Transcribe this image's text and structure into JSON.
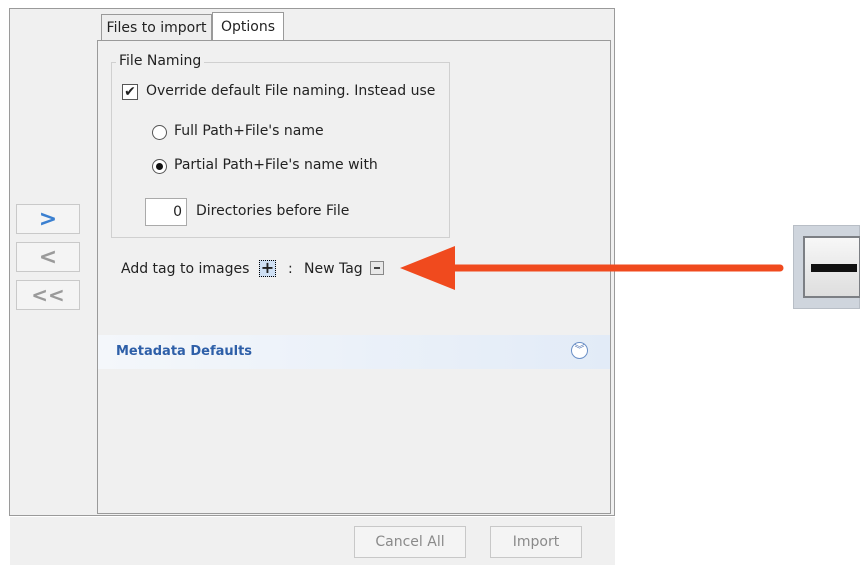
{
  "tabs": [
    {
      "label": "Files to import",
      "selected": false
    },
    {
      "label": "Options",
      "selected": true
    }
  ],
  "nav_buttons": [
    {
      "icon": "chevron-right-icon",
      "glyph": ">",
      "enabled": true
    },
    {
      "icon": "chevron-left-icon",
      "glyph": "<",
      "enabled": false
    },
    {
      "icon": "double-chevron-left-icon",
      "glyph": "<<",
      "enabled": false
    }
  ],
  "file_naming": {
    "group_title": "File Naming",
    "override_label": "Override default File naming. Instead use",
    "override_checked": true,
    "full_path_label": "Full Path+File's name",
    "partial_path_label": "Partial Path+File's name with",
    "selected_option": "partial",
    "directories_value": "0",
    "directories_label": "Directories before File"
  },
  "tags": {
    "add_label": "Add tag to images",
    "separator": ":",
    "new_tag_label": "New Tag"
  },
  "metadata": {
    "label": "Metadata Defaults"
  },
  "buttons": {
    "cancel_all": "Cancel All",
    "import": "Import"
  },
  "colors": {
    "accent_blue": "#3a7fd0",
    "annotation_arrow": "#f04a1e",
    "metadata_text": "#2e5fa8"
  }
}
